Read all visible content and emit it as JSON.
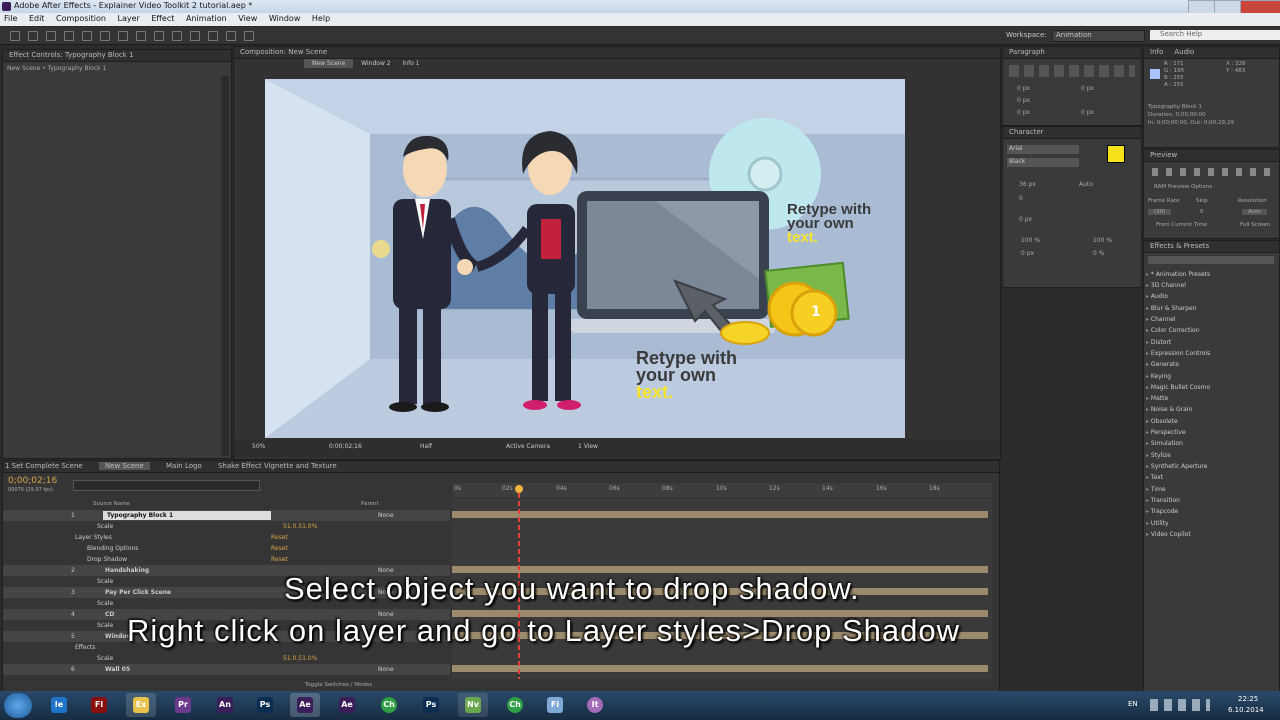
{
  "window": {
    "title": "Adobe After Effects - Explainer Video Toolkit 2 tutorial.aep *"
  },
  "menu": [
    "File",
    "Edit",
    "Composition",
    "Layer",
    "Effect",
    "Animation",
    "View",
    "Window",
    "Help"
  ],
  "workspace": {
    "label": "Workspace:",
    "value": "Animation",
    "search_placeholder": "Search Help"
  },
  "effect_controls": {
    "tab": "Effect Controls: Typography Block 1",
    "subtitle": "New Scene • Typography Block 1"
  },
  "composition": {
    "tab": "Composition: New Scene",
    "flow_tabs": [
      "New Scene",
      "Window 2",
      "Info 1"
    ],
    "zoom": "50%",
    "timecode": "0;00;02;16",
    "resolution": "Half",
    "camera": "Active Camera",
    "view": "1 View"
  },
  "scene": {
    "text1": {
      "line1": "Retype with",
      "line2": "your own",
      "line3": "text."
    },
    "text2": {
      "line1": "Retype with",
      "line2": "your own",
      "line3": "text."
    },
    "coin_label": "1"
  },
  "paragraph": {
    "tab": "Paragraph",
    "fields": [
      "0 px",
      "0 px",
      "0 px",
      "0 px",
      "0 px"
    ]
  },
  "character": {
    "tab": "Character",
    "font": "Arial",
    "style": "Black",
    "size": "36 px",
    "leading": "Auto",
    "tracking": "0",
    "scale_v": "100 %",
    "scale_h": "100 %",
    "baseline": "0 px",
    "tsume": "0 %"
  },
  "info": {
    "tab": "Info",
    "tab2": "Audio",
    "r": "R : 171",
    "g": "G : 195",
    "b": "B : 255",
    "a": "A : 255",
    "x": "X : 328",
    "y": "Y : 483",
    "layer": "Typography Block 1",
    "duration": "Duration: 0;00;00;00",
    "inout": "In: 0;00;00;00, Out: 0;00;29;29"
  },
  "preview": {
    "tab": "Preview",
    "ram_options": "RAM Preview Options",
    "frame_rate_label": "Frame Rate",
    "skip_label": "Skip",
    "resolution_label": "Resolution",
    "frame_rate": "(30)",
    "skip": "0",
    "resolution": "Auto",
    "from_current": "From Current Time",
    "full_screen": "Full Screen"
  },
  "effects_presets": {
    "tab": "Effects & Presets",
    "items": [
      "* Animation Presets",
      "3D Channel",
      "Audio",
      "Blur & Sharpen",
      "Channel",
      "Color Correction",
      "Distort",
      "Expression Controls",
      "Generate",
      "Keying",
      "Magic Bullet Cosmo",
      "Matte",
      "Noise & Grain",
      "Obsolete",
      "Perspective",
      "Simulation",
      "Stylize",
      "Synthetic Aperture",
      "Text",
      "Time",
      "Transition",
      "Trapcode",
      "Utility",
      "Video Copilot"
    ]
  },
  "timeline": {
    "tabs": [
      "1 Set Complete Scene",
      "New Scene",
      "Main Logo",
      "Shake Effect Vignette and Texture"
    ],
    "timecode": "0;00;02;16",
    "fps": "00076 (29.97 fps)",
    "columns": {
      "source": "Source Name",
      "parent": "Parent"
    },
    "ruler": [
      "0s",
      "02s",
      "04s",
      "06s",
      "08s",
      "10s",
      "12s",
      "14s",
      "16s",
      "18s"
    ],
    "rows": [
      {
        "num": "1",
        "name": "Typography Block 1",
        "kind": "layer",
        "parent": "None"
      },
      {
        "name": "Scale",
        "kind": "prop",
        "value": "51.0,51.0%"
      },
      {
        "name": "Layer Styles",
        "kind": "group",
        "value": "Reset"
      },
      {
        "name": "Blending Options",
        "kind": "sub",
        "value": "Reset"
      },
      {
        "name": "Drop Shadow",
        "kind": "sub",
        "value": "Reset"
      },
      {
        "num": "2",
        "name": "Handshaking",
        "kind": "layer",
        "parent": "None"
      },
      {
        "name": "Scale",
        "kind": "prop",
        "value": ""
      },
      {
        "num": "3",
        "name": "Pay Per Click Scene",
        "kind": "layer",
        "parent": "None"
      },
      {
        "name": "Scale",
        "kind": "prop",
        "value": ""
      },
      {
        "num": "4",
        "name": "CD",
        "kind": "layer",
        "parent": "None"
      },
      {
        "name": "Scale",
        "kind": "prop",
        "value": ""
      },
      {
        "num": "5",
        "name": "Window",
        "kind": "layer",
        "parent": "None"
      },
      {
        "name": "Effects",
        "kind": "group",
        "value": ""
      },
      {
        "name": "Scale",
        "kind": "prop",
        "value": "51.0,51.0%"
      },
      {
        "num": "6",
        "name": "Wall 05",
        "kind": "layer",
        "parent": "None"
      }
    ],
    "toggle_label": "Toggle Switches / Modes"
  },
  "captions": {
    "line1": "Select object you want to drop shadow.",
    "line2": "Right click on layer and go to Layer styles>Drop Shadow"
  },
  "taskbar": {
    "apps": [
      "Ie",
      "Fl",
      "Ex",
      "Pr",
      "An",
      "Ps",
      "Ae",
      "Ae",
      "Ch",
      "Ps",
      "Nv",
      "Ch",
      "Fi",
      "It"
    ],
    "lang": "EN",
    "time": "22:25",
    "date": "6.10.2014"
  },
  "colors": {
    "accent": "#f6e52c",
    "timecode": "#d8a74a",
    "playhead": "#e84040"
  }
}
